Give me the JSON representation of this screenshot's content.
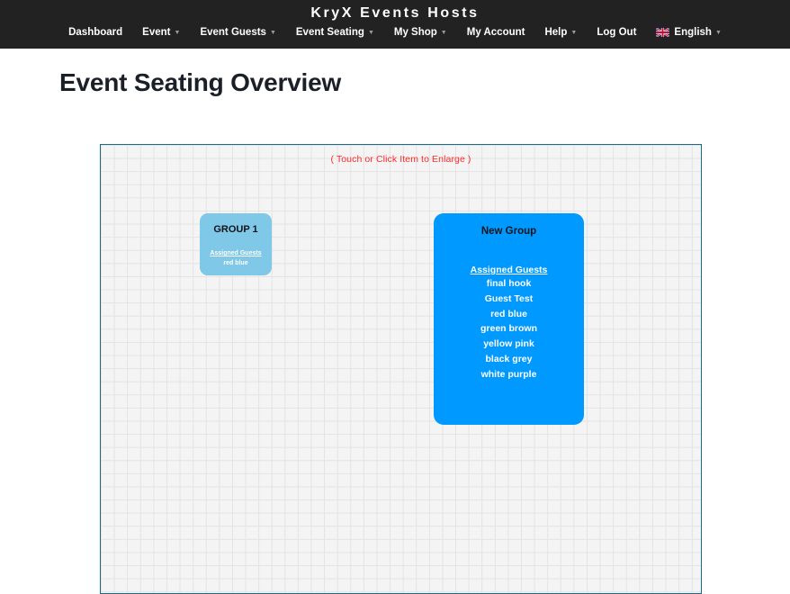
{
  "header": {
    "brand": "KryX Events Hosts",
    "nav": [
      {
        "label": "Dashboard",
        "has_caret": false
      },
      {
        "label": "Event",
        "has_caret": true
      },
      {
        "label": "Event Guests",
        "has_caret": true
      },
      {
        "label": "Event Seating",
        "has_caret": true
      },
      {
        "label": "My Shop",
        "has_caret": true
      },
      {
        "label": "My Account",
        "has_caret": false
      },
      {
        "label": "Help",
        "has_caret": true
      },
      {
        "label": "Log Out",
        "has_caret": false
      }
    ],
    "language": {
      "label": "English",
      "icon": "uk-flag-icon",
      "has_caret": true
    },
    "bg_color": "#222222"
  },
  "page": {
    "title": "Event Seating Overview"
  },
  "canvas": {
    "hint": "( Touch or Click Item to Enlarge )",
    "hint_color": "#ff2b2b",
    "border_color": "#1b6a8a",
    "grid_color": "#e3e3e3",
    "bg_color": "#f4f4f4"
  },
  "groups": [
    {
      "name": "GROUP 1",
      "color": "#7fc8e8",
      "assigned_label": "Assigned Guests",
      "guests": [
        "red blue"
      ]
    },
    {
      "name": "New Group",
      "color": "#0099ff",
      "assigned_label": "Assigned Guests",
      "guests": [
        "final hook",
        "Guest Test",
        "red blue",
        "green brown",
        "yellow pink",
        "black grey",
        "white purple"
      ]
    }
  ]
}
